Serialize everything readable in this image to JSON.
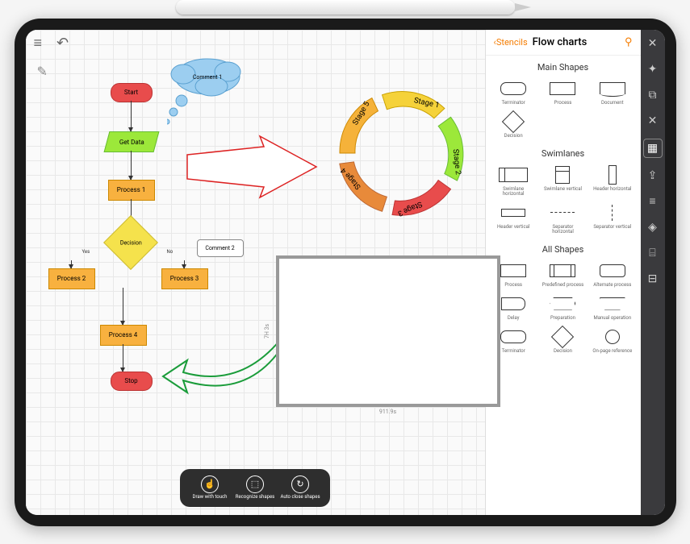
{
  "toolbar": {
    "menu": "≡",
    "undo": "↶"
  },
  "flowchart": {
    "start": "Start",
    "get_data": "Get Data",
    "process1": "Process 1",
    "decision": "Decision",
    "process2": "Process 2",
    "process3": "Process 3",
    "process4": "Process 4",
    "stop": "Stop",
    "comment1": "Comment 1",
    "comment2": "Comment 2",
    "yes": "Yes",
    "no": "No"
  },
  "cycle": {
    "s1": "Stage 1",
    "s2": "Stage 2",
    "s3": "Stage 3",
    "s4": "Stage 4",
    "s5": "Stage 5"
  },
  "floorplan": {
    "width": "911.9s",
    "height": "7H 3s"
  },
  "bottom": {
    "draw": "Draw with touch",
    "recognize": "Recognize shapes",
    "autoclose": "Auto close shapes"
  },
  "stencils": {
    "back": "Stencils",
    "title": "Flow charts",
    "sections": {
      "main": "Main Shapes",
      "swim": "Swimlanes",
      "all": "All Shapes"
    },
    "shapes": {
      "terminator": "Terminator",
      "process": "Process",
      "document": "Document",
      "decision": "Decision",
      "swimh": "Swimlane horizontal",
      "swimv": "Swimlane vertical",
      "hdh": "Header horizontal",
      "hdv": "Header vertical",
      "seph": "Separator horizontal",
      "sepv": "Separator vertical",
      "predef": "Predefined process",
      "altproc": "Alternate process",
      "delay": "Delay",
      "prep": "Preparation",
      "manop": "Manual operation",
      "onpage": "On-page reference"
    }
  }
}
